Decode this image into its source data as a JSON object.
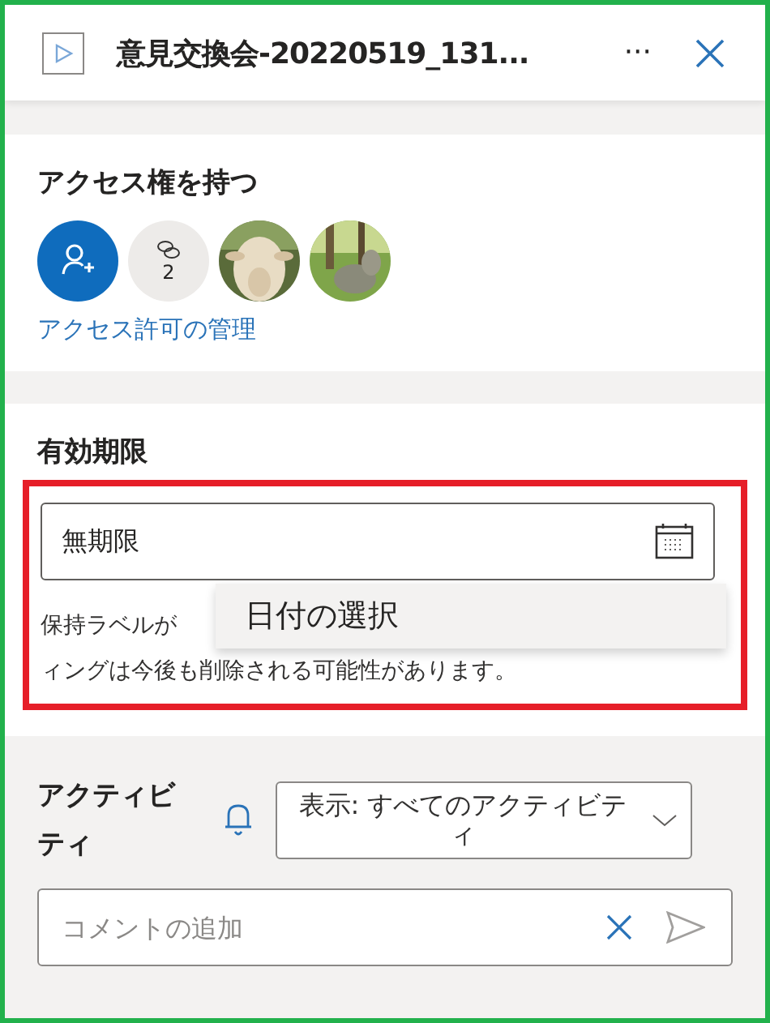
{
  "header": {
    "title": "意見交換会-20220519_131...",
    "more": "···"
  },
  "access": {
    "heading": "アクセス権を持つ",
    "avatars": [
      {
        "kind": "add"
      },
      {
        "kind": "links",
        "count": "2"
      },
      {
        "kind": "picture"
      },
      {
        "kind": "picture"
      }
    ],
    "manage_link": "アクセス許可の管理"
  },
  "expiry": {
    "heading": "有効期限",
    "value": "無期限",
    "note_lines": [
      "保持ラベルが",
      "ィングは今後も削除される可能性があります。"
    ],
    "popup": {
      "item": "日付の選択"
    }
  },
  "activity": {
    "heading": "アクティビティ",
    "filter": "表示: すべてのアクティビティ",
    "comment": {
      "placeholder": "コメントの追加"
    }
  }
}
